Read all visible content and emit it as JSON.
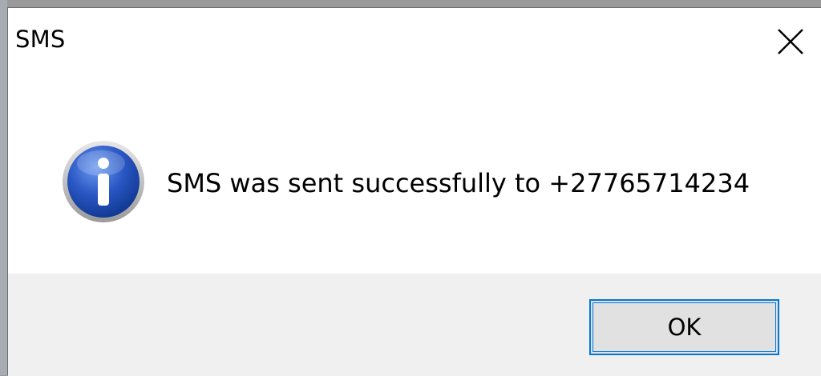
{
  "dialog": {
    "title": "SMS",
    "close_icon": "close-icon",
    "message_icon": "info-icon",
    "message": "SMS was sent successfully to +27765714234",
    "ok_label": "OK"
  },
  "colors": {
    "footer_bg": "#f0f0f0",
    "button_bg": "#e1e1e1",
    "button_border": "#0078d7",
    "icon_blue": "#1f4db3"
  }
}
